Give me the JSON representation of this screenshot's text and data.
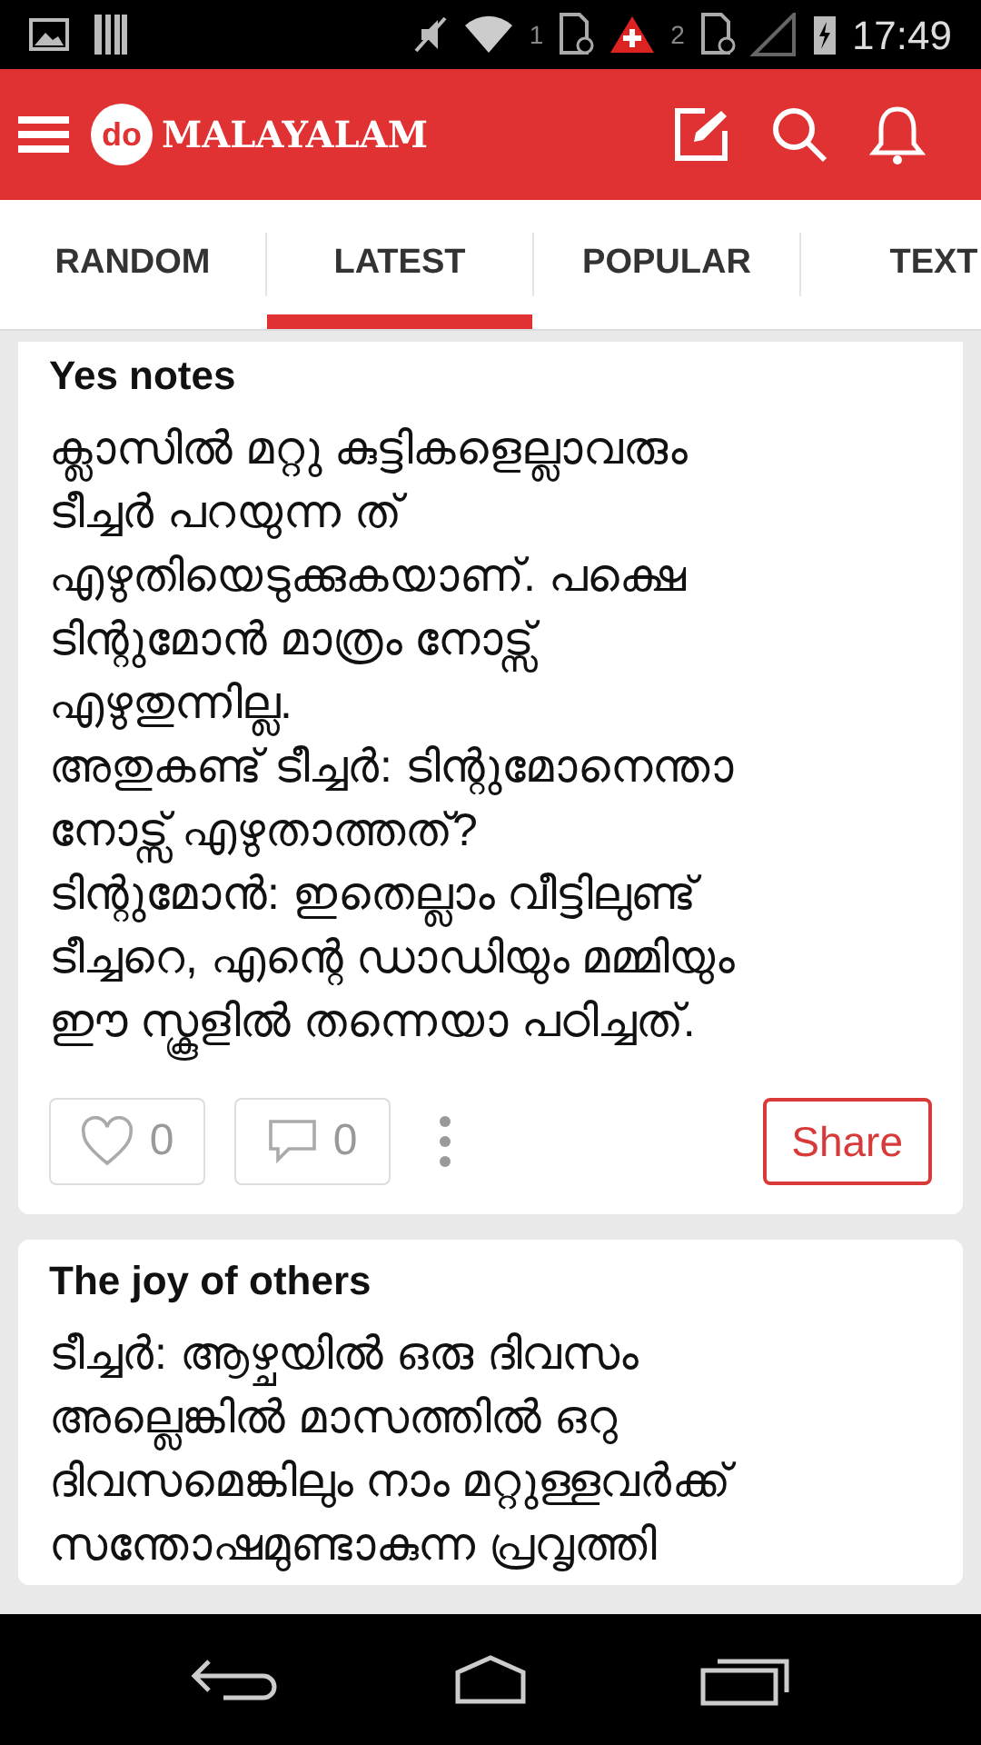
{
  "status_bar": {
    "sim_1": "1",
    "sim_2": "2",
    "time": "17:49"
  },
  "header": {
    "logo_mark": "do",
    "title": "MALAYALAM"
  },
  "tabs": [
    {
      "label": "RANDOM",
      "selected": false
    },
    {
      "label": "LATEST",
      "selected": true
    },
    {
      "label": "POPULAR",
      "selected": false
    },
    {
      "label": "TEXT",
      "selected": false
    }
  ],
  "posts": [
    {
      "title": "Yes notes",
      "lines": [
        "ക്ലാസിൽ മറ്റു കുട്ടികളെല്ലാവരും",
        "ടീച്ചർ പറയുന്ന ത്",
        "എഴുതിയെടുക്കുകയാണ്. പക്ഷെ",
        "ടിന്റുമോൻ മാത്രം നോട്സ്",
        "എഴുതുന്നില്ല.",
        "അതുകണ്ട് ടീച്ചർ: ടിന്റുമോനെന്താ",
        "നോട്സ് എഴുതാത്തത്?",
        "ടിന്റുമോൻ: ഇതെല്ലാം വീട്ടിലുണ്ട്",
        "ടീച്ചറെ, എന്റെ ഡാഡിയും മമ്മിയും",
        "ഈ സ്കൂളിൽ തന്നെയാ പഠിച്ചത്."
      ],
      "likes": "0",
      "comments": "0",
      "share": "Share"
    },
    {
      "title": "The joy of others",
      "lines": [
        "ടീച്ചർ: ആഴ്ചയിൽ ഒരു ദിവസം",
        "അല്ലെങ്കിൽ മാസത്തിൽ ഒറു",
        "ദിവസമെങ്കിലും നാം മറ്റുള്ളവർക്ക്",
        "സന്തോഷമുണ്ടാകുന്ന പ്രവൃത്തി"
      ]
    }
  ]
}
